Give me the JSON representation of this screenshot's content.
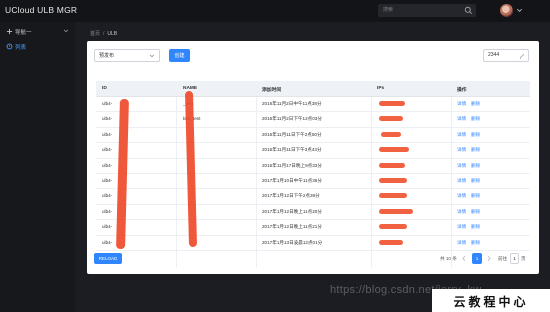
{
  "app": {
    "title": "UCloud ULB MGR"
  },
  "search": {
    "placeholder": "搜索"
  },
  "sidebar": {
    "items": [
      {
        "label": "导航一"
      },
      {
        "label": "列表"
      }
    ]
  },
  "breadcrumb": {
    "home": "首页",
    "separator": "/",
    "current": "ULB"
  },
  "toolbar": {
    "filter_value": "预发布",
    "create_label": "创建",
    "number_value": "2344"
  },
  "table": {
    "headers": {
      "id": "ID",
      "name": "NAME",
      "created": "添加时间",
      "ips": "IPs",
      "actions": "操作"
    },
    "rows": [
      {
        "id": "ulb4-",
        "name": "_test",
        "created": "2016年11月2日中午11点38分",
        "detail": "详情",
        "delete": "删除"
      },
      {
        "id": "ulb4-",
        "name": "bbs_test",
        "created": "2016年11月2日下午12点03分",
        "detail": "详情",
        "delete": "删除"
      },
      {
        "id": "ulb4-",
        "name": "",
        "created": "2016年11月11日下午2点50分",
        "detail": "详情",
        "delete": "删除"
      },
      {
        "id": "ulb4-",
        "name": "",
        "created": "2016年11月11日下午3点43分",
        "detail": "详情",
        "delete": "删除"
      },
      {
        "id": "ulb4-",
        "name": "",
        "created": "2016年11月17日晚上9点33分",
        "detail": "详情",
        "delete": "删除"
      },
      {
        "id": "ulb4-",
        "name": "",
        "created": "2017年1月10日中午11点36分",
        "detail": "详情",
        "delete": "删除"
      },
      {
        "id": "ulb4-",
        "name": "",
        "created": "2017年1月12日下午2点39分",
        "detail": "详情",
        "delete": "删除"
      },
      {
        "id": "ulb4-",
        "name": "",
        "created": "2017年1月12日晚上11点20分",
        "detail": "详情",
        "delete": "删除"
      },
      {
        "id": "ulb4-",
        "name": "",
        "created": "2017年1月12日晚上11点21分",
        "detail": "详情",
        "delete": "删除"
      },
      {
        "id": "ulb4-",
        "name": "",
        "created": "2017年1月13日凌晨12点01分",
        "detail": "详情",
        "delete": "删除"
      }
    ]
  },
  "footer": {
    "reload_label": "RELOAD",
    "total_text": "共 10 条",
    "current_page": "1",
    "goto_label": "前往",
    "goto_value": "1",
    "goto_suffix": "页"
  },
  "watermark": {
    "text": "https://blog.csdn.net/jerry_kw..."
  },
  "corner_badge": {
    "text": "云教程中心"
  },
  "colors": {
    "accent": "#2f86ff",
    "redaction": "#f0512f",
    "background": "#1b1d22"
  },
  "icons": [
    "search-icon",
    "chevron-down-icon",
    "plus-icon",
    "list-icon",
    "edit-icon",
    "chevron-left-icon",
    "chevron-right-icon"
  ]
}
